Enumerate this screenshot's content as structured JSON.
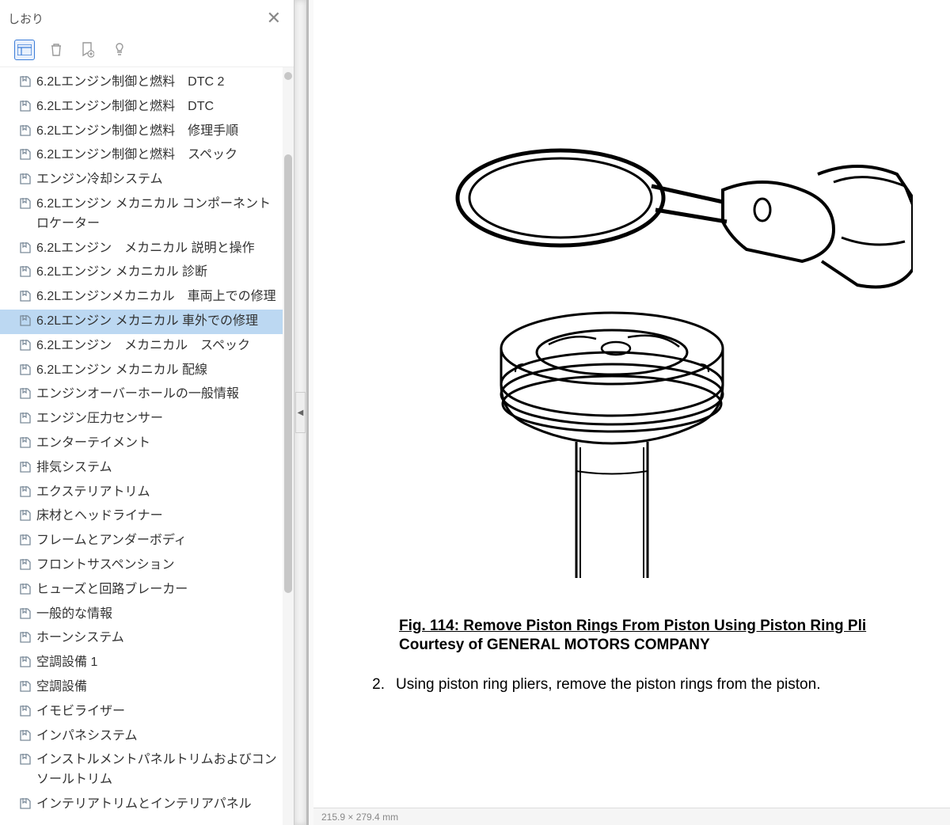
{
  "sidebar": {
    "title": "しおり",
    "items": [
      {
        "label": "6.2Lエンジン制御と燃料　DTC 2",
        "sel": false
      },
      {
        "label": "6.2Lエンジン制御と燃料　DTC",
        "sel": false
      },
      {
        "label": "6.2Lエンジン制御と燃料　修理手順",
        "sel": false
      },
      {
        "label": "6.2Lエンジン制御と燃料　スペック",
        "sel": false
      },
      {
        "label": "エンジン冷却システム",
        "sel": false
      },
      {
        "label": "6.2Lエンジン メカニカル コンポーネントロケーター",
        "sel": false
      },
      {
        "label": "6.2Lエンジン　メカニカル 説明と操作",
        "sel": false
      },
      {
        "label": "6.2Lエンジン メカニカル  診断",
        "sel": false
      },
      {
        "label": "6.2Lエンジンメカニカル　車両上での修理",
        "sel": false
      },
      {
        "label": "6.2Lエンジン メカニカル  車外での修理",
        "sel": true
      },
      {
        "label": "6.2Lエンジン　メカニカル　スペック",
        "sel": false
      },
      {
        "label": "6.2Lエンジン メカニカル  配線",
        "sel": false
      },
      {
        "label": "エンジンオーバーホールの一般情報",
        "sel": false
      },
      {
        "label": "エンジン圧力センサー",
        "sel": false
      },
      {
        "label": "エンターテイメント",
        "sel": false
      },
      {
        "label": "排気システム",
        "sel": false
      },
      {
        "label": "エクステリアトリム",
        "sel": false
      },
      {
        "label": "床材とヘッドライナー",
        "sel": false
      },
      {
        "label": "フレームとアンダーボディ",
        "sel": false
      },
      {
        "label": "フロントサスペンション",
        "sel": false
      },
      {
        "label": "ヒューズと回路ブレーカー",
        "sel": false
      },
      {
        "label": "一般的な情報",
        "sel": false
      },
      {
        "label": "ホーンシステム",
        "sel": false
      },
      {
        "label": "空調設備 1",
        "sel": false
      },
      {
        "label": "空調設備",
        "sel": false
      },
      {
        "label": "イモビライザー",
        "sel": false
      },
      {
        "label": "インパネシステム",
        "sel": false
      },
      {
        "label": "インストルメントパネルトリムおよびコンソールトリム",
        "sel": false
      },
      {
        "label": "インテリアトリムとインテリアパネル",
        "sel": false
      }
    ]
  },
  "content": {
    "figure_title": "Fig. 114: Remove Piston Rings From Piston Using Piston Ring Pli",
    "courtesy": "Courtesy of GENERAL MOTORS COMPANY",
    "step_num": "2.",
    "step_text": "Using piston ring pliers, remove the piston rings from the piston.",
    "status": "215.9 × 279.4 mm"
  }
}
